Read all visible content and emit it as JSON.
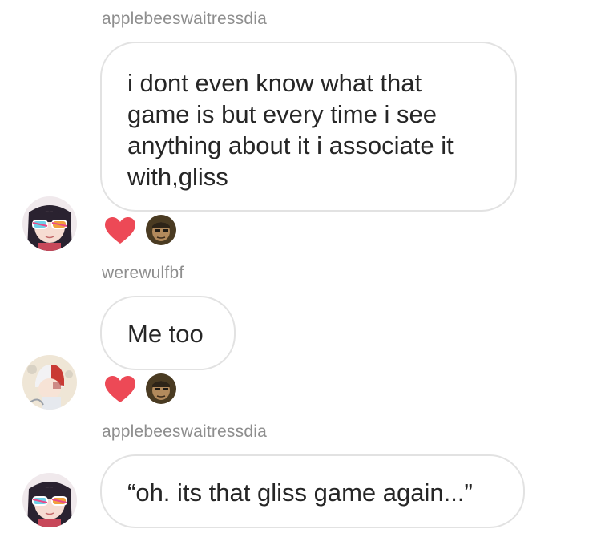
{
  "messages": [
    {
      "username": "applebeeswaitressdia",
      "lines": [
        "i dont even know what that",
        "game is but every time i see",
        "anything about it i associate it",
        "with,gliss"
      ],
      "reaction": "heart-icon"
    },
    {
      "username": "werewulfbf",
      "lines": [
        "Me too"
      ],
      "reaction": "heart-icon"
    },
    {
      "username": "applebeeswaitressdia",
      "lines": [
        "“oh. its that gliss game again...”"
      ]
    }
  ],
  "colors": {
    "heart": "#ed4956",
    "username": "#8e8e8e",
    "bubble_border": "#e2e2e2",
    "text": "#262626"
  }
}
